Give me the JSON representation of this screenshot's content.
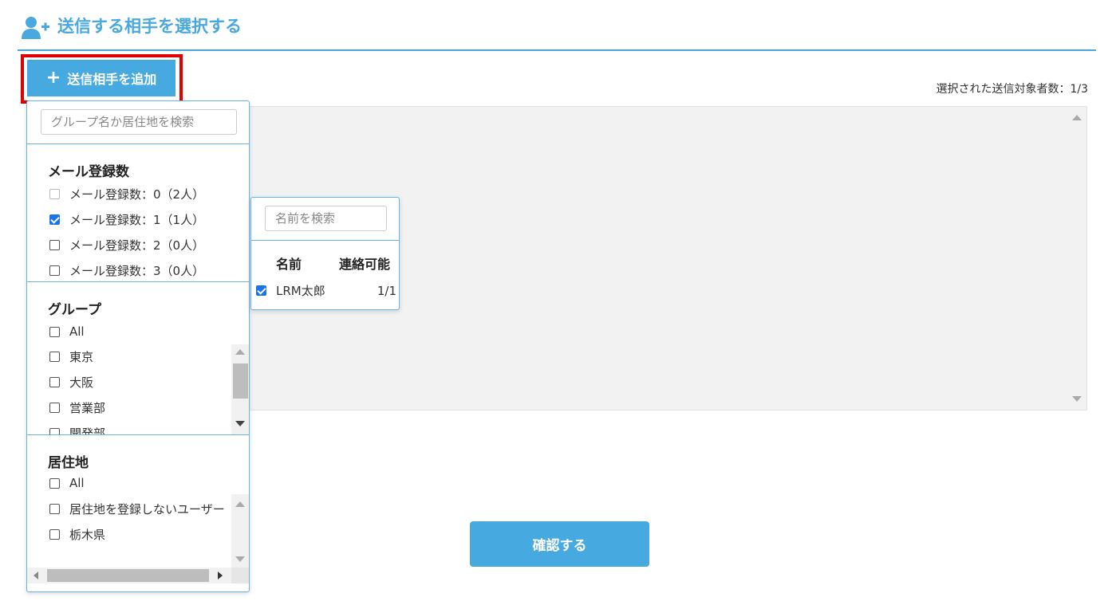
{
  "header": {
    "title": "送信する相手を選択する",
    "icon": "user-plus-icon"
  },
  "toolbar": {
    "add_label": "送信相手を追加",
    "add_icon": "plus-icon"
  },
  "count": {
    "text": "選択された送信対象者数：1/3"
  },
  "dropdown": {
    "search_placeholder": "グループ名か居住地を検索",
    "mail": {
      "title": "メール登録数",
      "items": [
        {
          "label": "メール登録数：0（2人）",
          "checked": false,
          "disabled": true
        },
        {
          "label": "メール登録数：1（1人）",
          "checked": true,
          "disabled": false
        },
        {
          "label": "メール登録数：2（0人）",
          "checked": false,
          "disabled": false
        },
        {
          "label": "メール登録数：3（0人）",
          "checked": false,
          "disabled": false
        }
      ]
    },
    "group": {
      "title": "グループ",
      "items": [
        {
          "label": "All"
        },
        {
          "label": "東京"
        },
        {
          "label": "大阪"
        },
        {
          "label": "営業部"
        },
        {
          "label": "開発部"
        }
      ]
    },
    "residence": {
      "title": "居住地",
      "items": [
        {
          "label": "All"
        },
        {
          "label": "居住地を登録しないユーザー"
        },
        {
          "label": "栃木県"
        }
      ]
    }
  },
  "name_popup": {
    "search_placeholder": "名前を検索",
    "headers": {
      "name": "名前",
      "contact": "連絡可能"
    },
    "rows": [
      {
        "name": "LRM太郎",
        "contact": "1/1",
        "checked": true
      }
    ]
  },
  "confirm": {
    "label": "確認する"
  },
  "colors": {
    "accent": "#46a9df",
    "highlight": "#e00000",
    "checkbox": "#1a73e8"
  }
}
